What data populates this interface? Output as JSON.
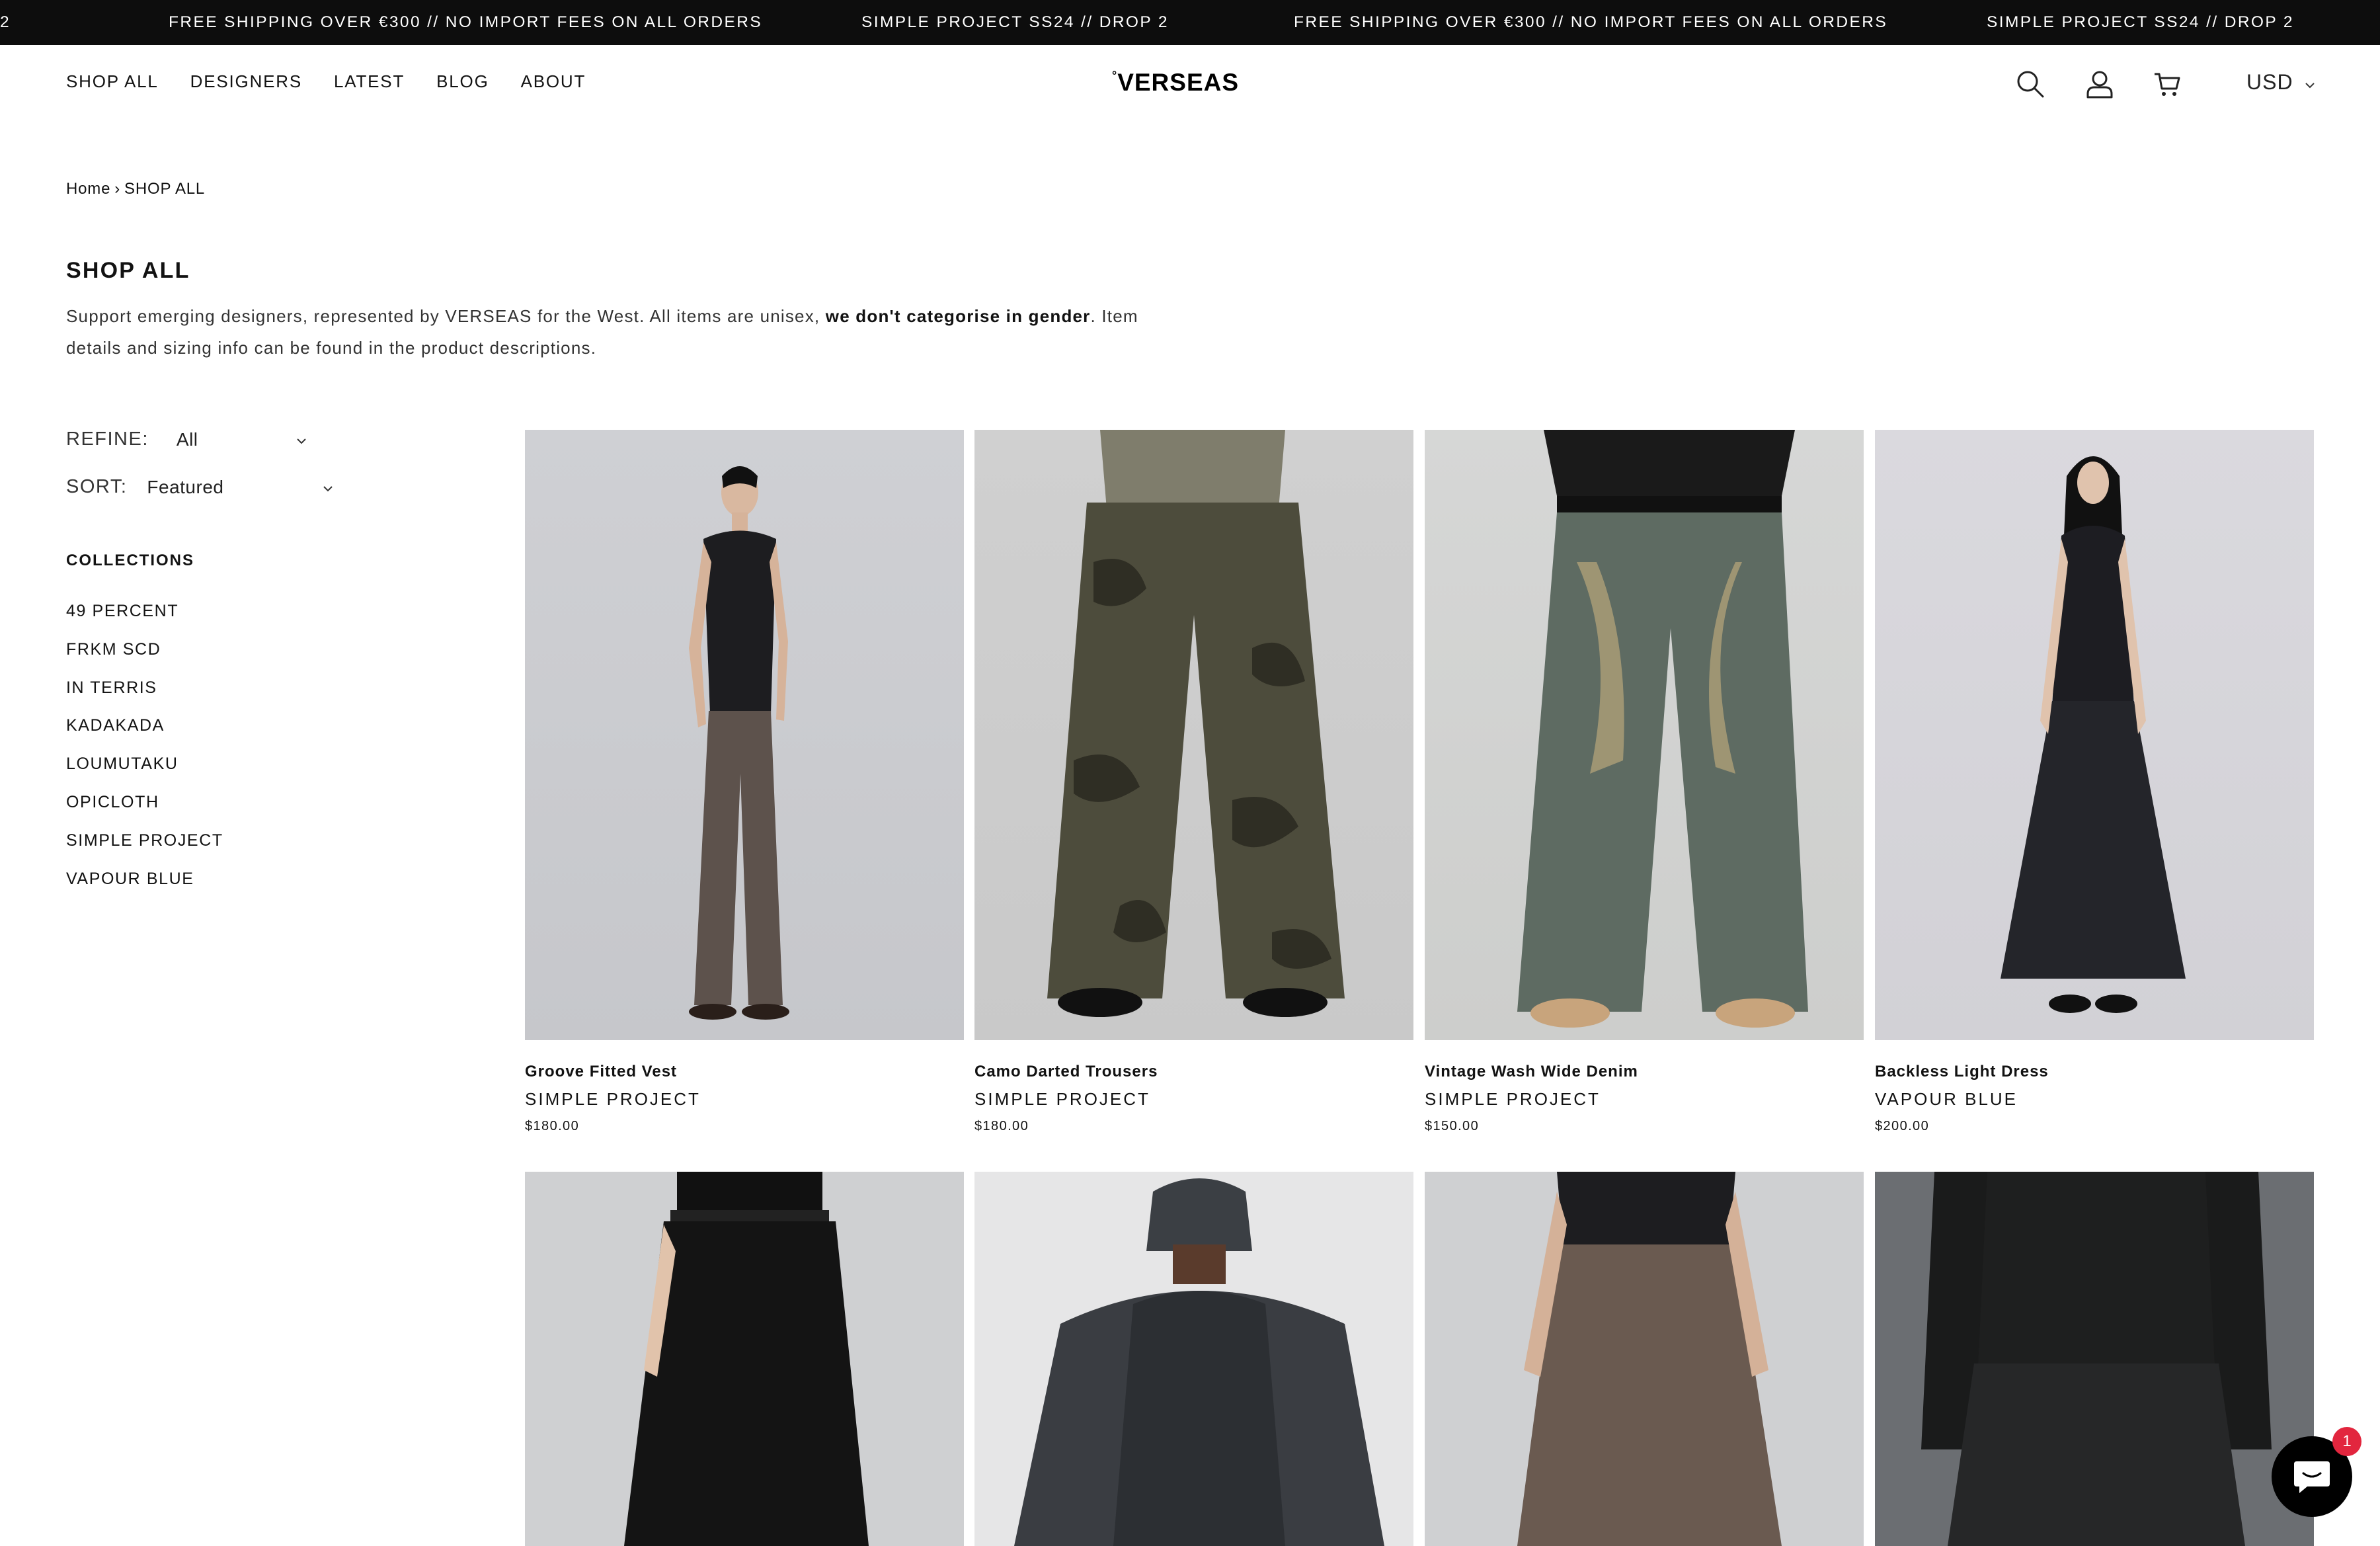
{
  "announcement": {
    "items": [
      "2",
      "FREE SHIPPING OVER €300 // NO IMPORT FEES ON ALL ORDERS",
      "SIMPLE PROJECT SS24 // DROP 2",
      "FREE SHIPPING OVER €300 // NO IMPORT FEES ON ALL ORDERS",
      "SIMPLE PROJECT SS24 // DROP 2"
    ]
  },
  "header": {
    "nav": [
      "SHOP ALL",
      "DESIGNERS",
      "LATEST",
      "BLOG",
      "ABOUT"
    ],
    "logo_mark": "°",
    "logo_text": "VERSEAS",
    "currency": "USD",
    "icons": [
      "search-icon",
      "account-icon",
      "cart-icon"
    ]
  },
  "breadcrumb": {
    "home": "Home",
    "separator": "›",
    "current": "SHOP ALL"
  },
  "page": {
    "title": "SHOP ALL",
    "desc_part1": "Support emerging designers, represented by VERSEAS for the West. All items are unisex, ",
    "desc_bold": "we don't categorise in gender",
    "desc_part2": ". Item details and sizing info can be found in the product descriptions."
  },
  "filters": {
    "refine_label": "REFINE:",
    "refine_value": "All",
    "sort_label": "SORT:",
    "sort_value": "Featured"
  },
  "collections": {
    "title": "COLLECTIONS",
    "items": [
      "49 PERCENT",
      "FRKM SCD",
      "IN TERRIS",
      "KADAKADA",
      "LOUMUTAKU",
      "OPICLOTH",
      "SIMPLE PROJECT",
      "VAPOUR BLUE"
    ]
  },
  "products": [
    {
      "name": "Groove Fitted Vest",
      "vendor": "SIMPLE PROJECT",
      "price": "$180.00"
    },
    {
      "name": "Camo Darted Trousers",
      "vendor": "SIMPLE PROJECT",
      "price": "$180.00"
    },
    {
      "name": "Vintage Wash Wide Denim",
      "vendor": "SIMPLE PROJECT",
      "price": "$150.00"
    },
    {
      "name": "Backless Light Dress",
      "vendor": "VAPOUR BLUE",
      "price": "$200.00"
    }
  ],
  "chat": {
    "badge": "1"
  }
}
